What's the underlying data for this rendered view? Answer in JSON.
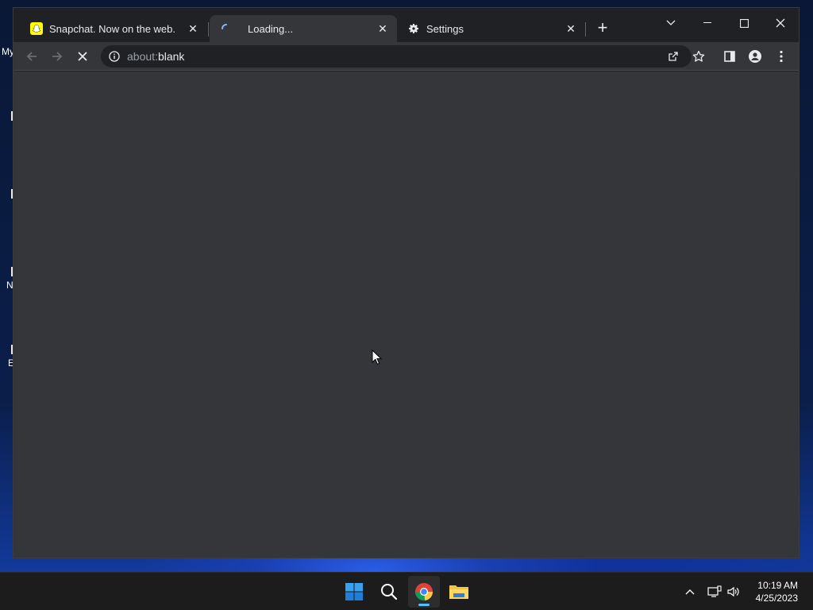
{
  "desktop": {
    "fragments": [
      "My",
      "N",
      "E"
    ]
  },
  "browser": {
    "tabs": [
      {
        "title": "Snapchat. Now on the web.",
        "favicon": "snapchat-icon",
        "active": false
      },
      {
        "title": "Loading...",
        "favicon": "loading-spinner-icon",
        "active": true
      },
      {
        "title": "Settings",
        "favicon": "gear-icon",
        "active": false
      }
    ],
    "new_tab_label": "+",
    "omnibox": {
      "scheme": "about:",
      "path": "blank"
    },
    "colors": {
      "frame": "#202124",
      "toolbar": "#35363a",
      "content": "#35363a",
      "text": "#e8eaed"
    }
  },
  "taskbar": {
    "apps": [
      "start-icon",
      "search-icon",
      "chrome-icon",
      "file-explorer-icon"
    ],
    "clock": {
      "time": "10:19 AM",
      "date": "4/25/2023"
    },
    "accent": "#4cc2ff"
  }
}
